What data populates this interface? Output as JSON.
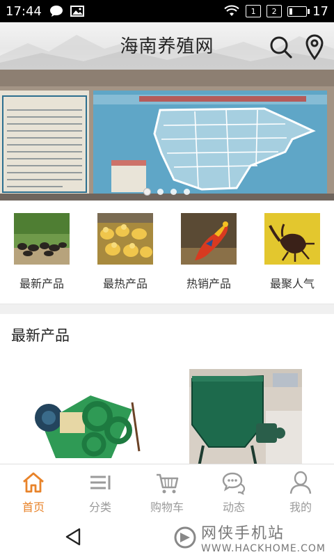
{
  "status_bar": {
    "time": "17:44",
    "sim1": "1",
    "sim2": "2",
    "battery_level": "17",
    "icons": [
      "message-icon",
      "image-icon",
      "wifi-icon"
    ]
  },
  "header": {
    "title": "海南养殖网",
    "icons": [
      "search-icon",
      "location-pin-icon"
    ]
  },
  "banner": {
    "slide_count": 4,
    "active_index": 0
  },
  "quick_links": [
    {
      "label": "最新产品",
      "image": "cattle-herd"
    },
    {
      "label": "最热产品",
      "image": "ducklings"
    },
    {
      "label": "热销产品",
      "image": "golden-pheasant"
    },
    {
      "label": "最聚人气",
      "image": "rhinoceros-beetle"
    }
  ],
  "section": {
    "title": "最新产品"
  },
  "products": [
    {
      "image": "green-feed-machine"
    },
    {
      "image": "green-mixer-machine"
    }
  ],
  "tabbar": {
    "tabs": [
      {
        "label": "首页",
        "icon": "home-icon",
        "active": true
      },
      {
        "label": "分类",
        "icon": "category-list-icon",
        "active": false
      },
      {
        "label": "购物车",
        "icon": "cart-icon",
        "active": false
      },
      {
        "label": "动态",
        "icon": "chat-bubbles-icon",
        "active": false
      },
      {
        "label": "我的",
        "icon": "user-icon",
        "active": false
      }
    ]
  },
  "watermark": {
    "name": "网侠手机站",
    "url": "WWW.HACKHOME.COM"
  },
  "colors": {
    "accent": "#e8832a",
    "inactive": "#9a9a9a",
    "status_bar": "#000000"
  }
}
